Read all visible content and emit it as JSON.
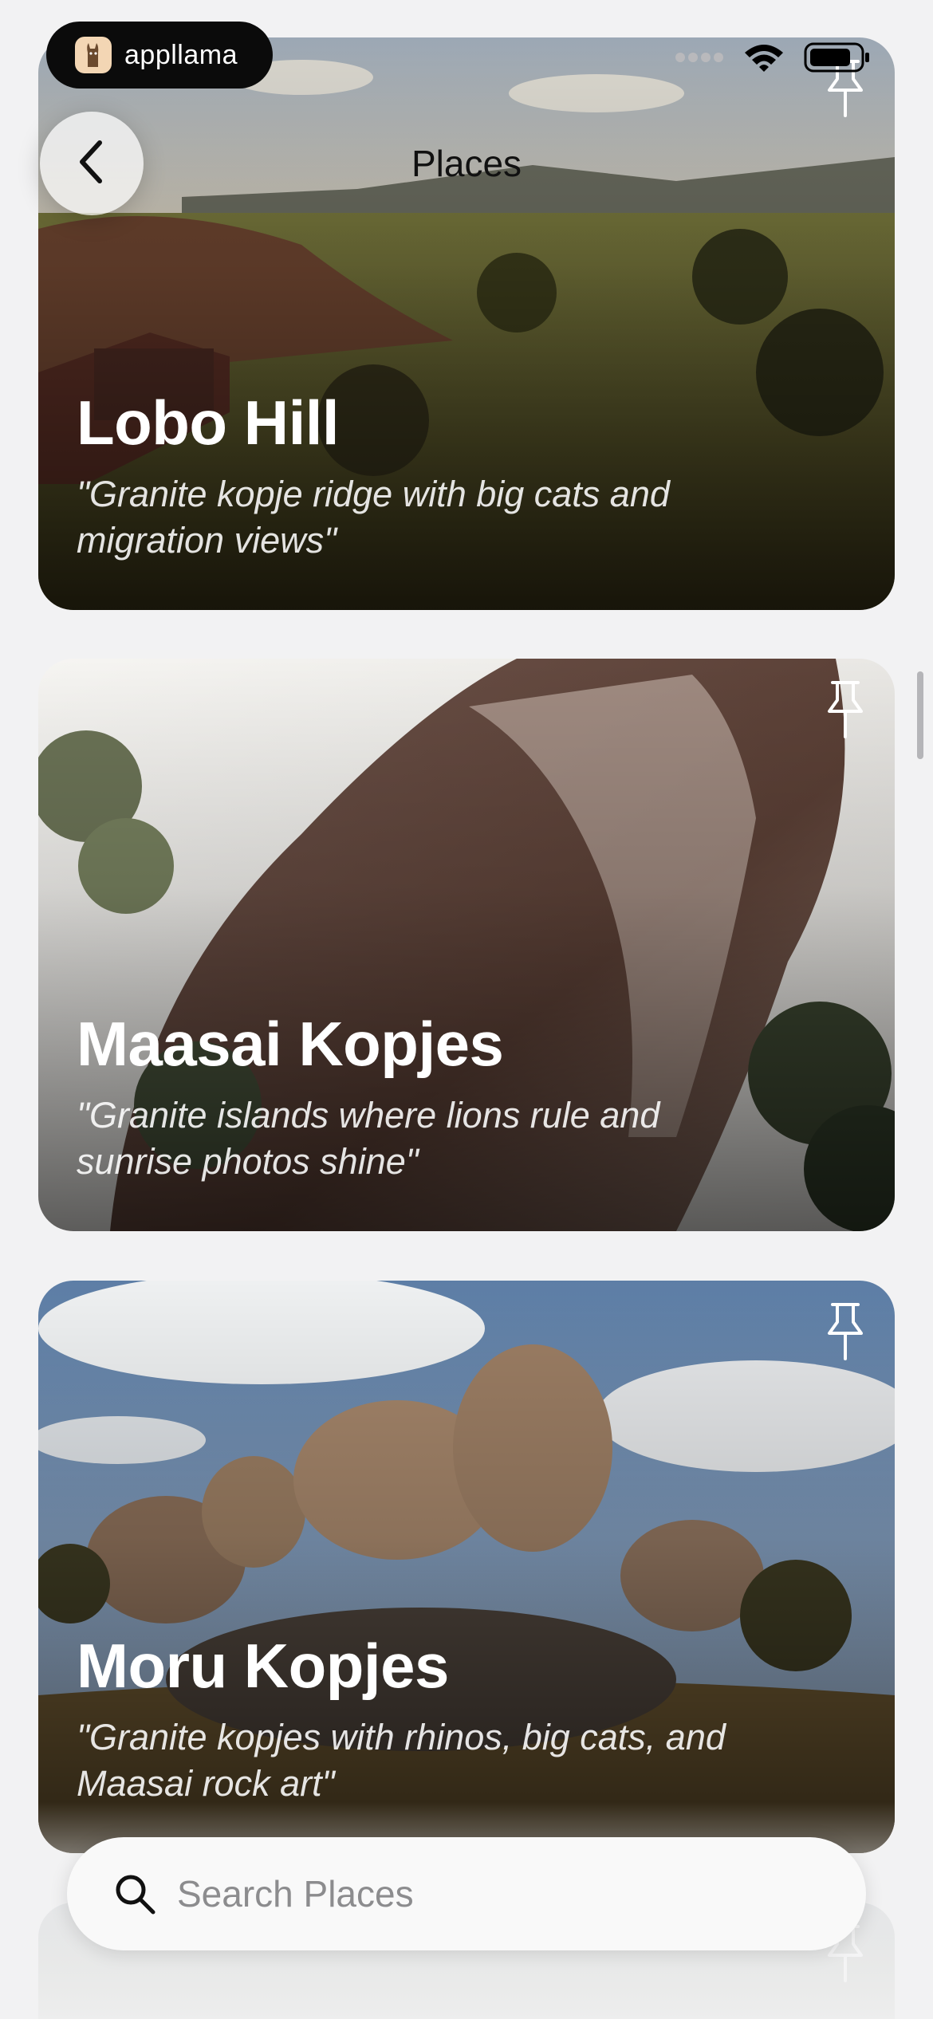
{
  "status_bar": {
    "brand_name": "appllama",
    "icons": [
      "signal-dots-icon",
      "wifi-icon",
      "battery-icon"
    ]
  },
  "nav": {
    "title": "Places",
    "back_icon": "chevron-left-icon"
  },
  "places": [
    {
      "title": "Lobo Hill",
      "tagline": "\"Granite kopje ridge with big cats and migration views\"",
      "pin_icon": "pin-icon"
    },
    {
      "title": "Maasai Kopjes",
      "tagline": "\"Granite islands where lions rule and sunrise photos shine\"",
      "pin_icon": "pin-icon"
    },
    {
      "title": "Moru Kopjes",
      "tagline": "\"Granite kopjes with rhinos, big cats, and Maasai rock art\"",
      "pin_icon": "pin-icon"
    }
  ],
  "search": {
    "placeholder": "Search Places",
    "value": "",
    "icon": "search-icon"
  }
}
